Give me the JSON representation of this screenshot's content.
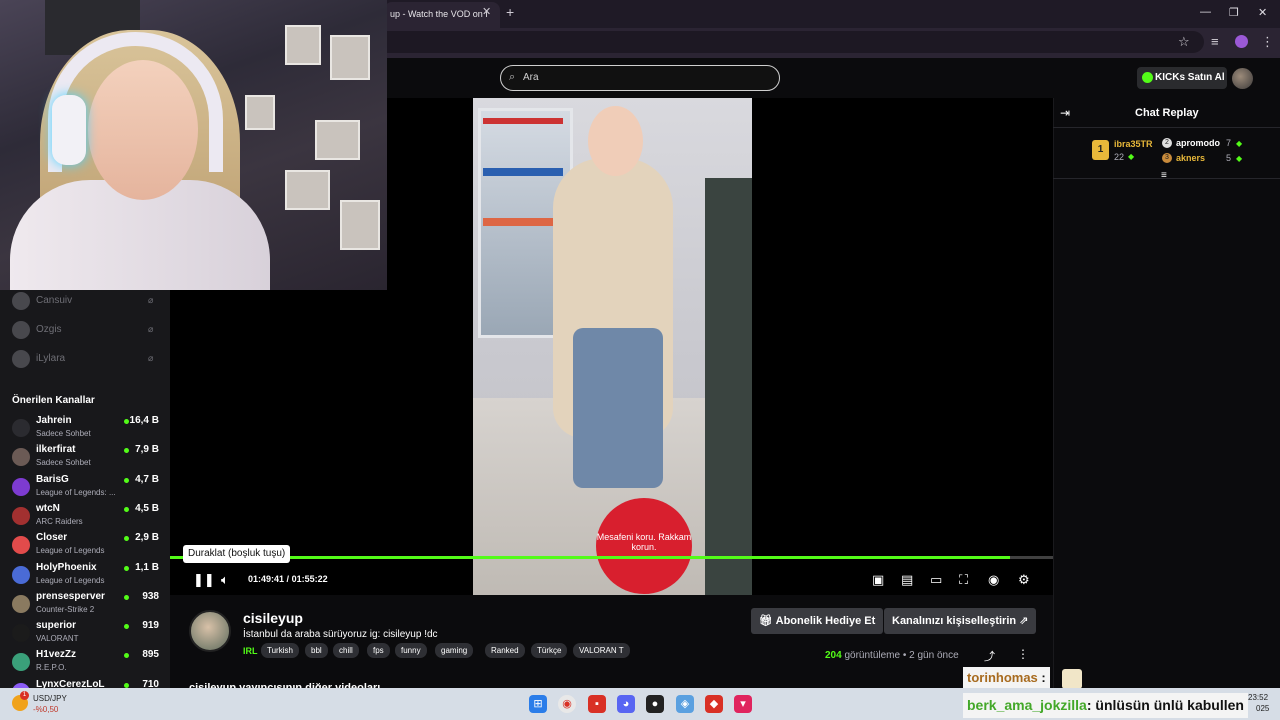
{
  "browser": {
    "tab_title": "up - Watch the VOD on I",
    "tab_close": "✕",
    "new_tab": "+",
    "win_min": "—",
    "win_max": "❐",
    "win_close": "✕"
  },
  "header": {
    "search_placeholder": "Ara",
    "kicks_button": "KICKs Satın Al"
  },
  "sidebar": {
    "following": [
      {
        "name": "Cansuiv"
      },
      {
        "name": "Ozgis"
      },
      {
        "name": "iLylara"
      }
    ],
    "recommended_title": "Önerilen Kanallar",
    "recommended": [
      {
        "name": "Jahrein",
        "category": "Sadece Sohbet",
        "viewers": "16,4 B",
        "color": "#2b2b30"
      },
      {
        "name": "ilkerfirat",
        "category": "Sadece Sohbet",
        "viewers": "7,9 B",
        "color": "#6b5a55"
      },
      {
        "name": "BarisG",
        "category": "League of Legends: ...",
        "viewers": "4,7 B",
        "color": "#7d3bd1"
      },
      {
        "name": "wtcN",
        "category": "ARC Raiders",
        "viewers": "4,5 B",
        "color": "#a23030"
      },
      {
        "name": "Closer",
        "category": "League of Legends",
        "viewers": "2,9 B",
        "color": "#e24b4b"
      },
      {
        "name": "HolyPhoenix",
        "category": "League of Legends",
        "viewers": "1,1 B",
        "color": "#4a6bd6"
      },
      {
        "name": "prensesperver",
        "category": "Counter-Strike 2",
        "viewers": "938",
        "color": "#8a7a60"
      },
      {
        "name": "superior",
        "category": "VALORANT",
        "viewers": "919",
        "color": "#1b1b1b"
      },
      {
        "name": "H1vezZz",
        "category": "R.E.P.O.",
        "viewers": "895",
        "color": "#3aa07a"
      },
      {
        "name": "LynxCerezLoL",
        "category": "",
        "viewers": "710",
        "color": "#8b5cf6"
      }
    ]
  },
  "player": {
    "tooltip": "Duraklat (boşluk tuşu)",
    "current_time": "01:49:41",
    "separator": "/",
    "duration": "01:55:22",
    "progress_fraction": 0.951,
    "sign_text": "Mesafeni koru. Rakkam korun."
  },
  "channel": {
    "name": "cisileyup",
    "title": "İstanbul da araba sürüyoruz  ig: cisileyup !dc",
    "category": "IRL",
    "tags": [
      "Turkish",
      "bbl",
      "chill",
      "fps",
      "funny",
      "gaming",
      "Ranked",
      "Türkçe",
      "VALORAN T"
    ],
    "gift_button": "Abonelik Hediye Et",
    "customize_button": "Kanalınızı kişiselleştirin",
    "views_count": "204",
    "views_label": "görüntüleme",
    "dot": "•",
    "time_ago": "2 gün önce",
    "other_videos": "cisileyup yayıncısının diğer videoları"
  },
  "chat": {
    "title": "Chat Replay",
    "leaderboard": [
      {
        "rank": "1",
        "name": "ibra35TR",
        "count": "22",
        "color": "#e8b83a"
      },
      {
        "name": "apromodo",
        "count": "7",
        "color": "#ffffff"
      },
      {
        "name": "akners",
        "count": "5",
        "color": "#e8b83a"
      }
    ]
  },
  "overlay": {
    "user1": "torinhomas",
    "colon": ":",
    "user2": "berk_ama_jokzilla",
    "message2": ": ünlüsün ünlü kabullen"
  },
  "taskbar": {
    "ticker_badge": "1",
    "ticker_name": "USD/JPY",
    "ticker_change": "-%0,50",
    "time": "23:52",
    "date": "025"
  }
}
